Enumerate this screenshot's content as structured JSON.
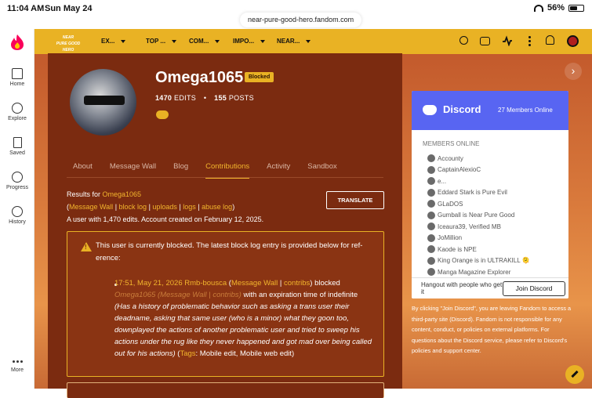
{
  "status": {
    "time": "11:04 AM",
    "date": "Sun May 24",
    "battery": "56%"
  },
  "url": "near-pure-good-hero.fandom.com",
  "rail": [
    {
      "label": "Home",
      "icon": "home-icon"
    },
    {
      "label": "Explore",
      "icon": "compass-icon"
    },
    {
      "label": "Saved",
      "icon": "bookmark-icon"
    },
    {
      "label": "Progress",
      "icon": "check-circle-icon"
    },
    {
      "label": "History",
      "icon": "history-icon"
    },
    {
      "label": "More",
      "icon": "more-dots-icon"
    }
  ],
  "wiki": {
    "logo_line1": "NEAR",
    "logo_line2": "PURE GOOD HERO"
  },
  "nav": [
    "EX...",
    "TOP ...",
    "COM...",
    "IMPO...",
    "NEAR..."
  ],
  "profile": {
    "username": "Omega1065",
    "badge": "Blocked",
    "edits_count": "1470",
    "edits_label": "EDITS",
    "posts_count": "155",
    "posts_label": "POSTS"
  },
  "tabs": [
    "About",
    "Message Wall",
    "Blog",
    "Contributions",
    "Activity",
    "Sandbox"
  ],
  "active_tab": "Contributions",
  "results": {
    "prefix": "Results for",
    "user": "Omega1065",
    "links": [
      "Message Wall",
      "block log",
      "uploads",
      "logs",
      "abuse log"
    ],
    "summary": "A user with 1,470 edits. Account created on February 12, 2025."
  },
  "translate_label": "TRANSLATE",
  "notice": {
    "line1": "This user is currently blocked. The latest block log entry is provided below for ref-",
    "line2": "erence:",
    "entry_time": "17:51, May 21, 2026",
    "entry_actor": "Rmb-bouscа",
    "actor_links": [
      "Message Wall",
      "contribs"
    ],
    "action": "blocked",
    "target": "Omega1065",
    "target_links": [
      "Message Wall",
      "contribs"
    ],
    "expiry": "with an expiration time of indefinite",
    "reason": "(Has a history of problematic behavior such as asking a trans user their deadname, asking that same user (who is a minor) what they goon too, downplayed the actions of another problematic user and tried to sweep his actions under the rug like they never happened and got mad over being called out for his actions)",
    "tags_label": "Tags",
    "tags": "Mobile edit, Mobile web edit"
  },
  "discord": {
    "name": "Discord",
    "members_online_count": "27 Members Online",
    "members_title": "MEMBERS ONLINE",
    "members": [
      "Accounty",
      "CaptainAlexioC",
      "e...",
      "Eddard Stark is Pure Evil",
      "GLaDOS",
      "Gumball is Near Pure Good",
      "Iceaura39, Verified MB",
      "JoMillion",
      "Kaode is NPE",
      "King Orange is in ULTRAKILL 🫠",
      "Manga Magazine Explorer"
    ],
    "hangout": "Hangout with people who get it",
    "join_label": "Join Discord",
    "disclaimer": "By clicking \"Join Discord\", you are leaving Fandom to access a third-party site (Discord). Fandom is not responsible for any content, conduct, or policies on external platforms. For questions about the Discord service, please refer to Discord's policies and support center."
  },
  "colors": {
    "accent": "#e9b224",
    "main_bg": "#7b2b10",
    "discord": "#5865f2"
  }
}
